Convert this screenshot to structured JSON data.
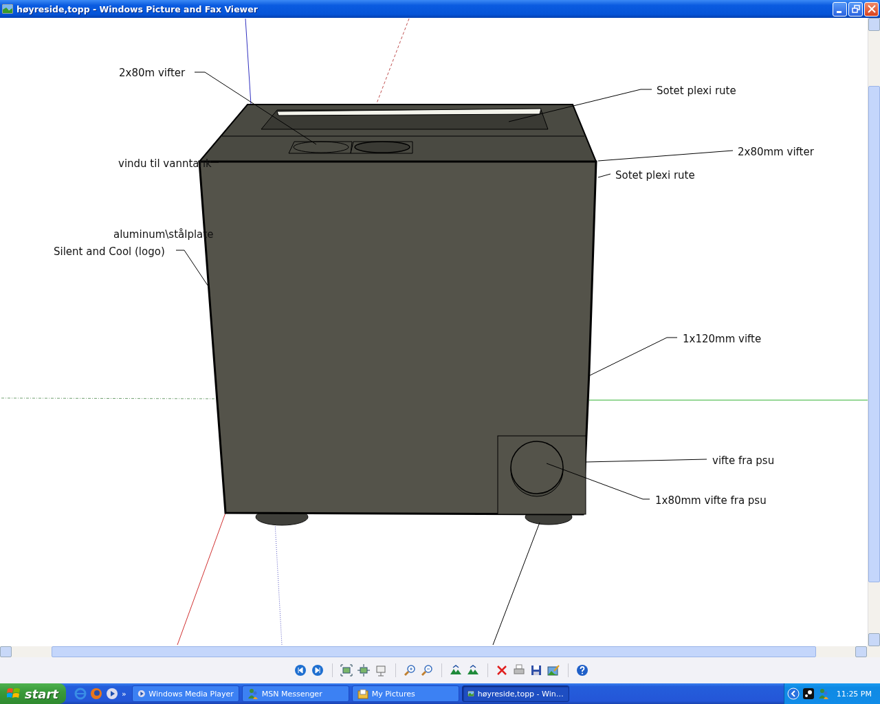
{
  "window": {
    "title": "høyreside,topp - Windows Picture and Fax Viewer"
  },
  "drawing": {
    "labels": [
      {
        "text": "2x80m vifter"
      },
      {
        "text": "Sotet plexi rute"
      },
      {
        "text": "vindu til vanntank"
      },
      {
        "text": "2x80mm vifter"
      },
      {
        "text": "Sotet plexi rute"
      },
      {
        "text": "aluminum\\stålplate"
      },
      {
        "text": "Silent and Cool (logo)"
      },
      {
        "text": "1x120mm vifte"
      },
      {
        "text": "vifte fra psu"
      },
      {
        "text": "1x80mm vifte fra psu"
      }
    ]
  },
  "taskbar": {
    "start": "start",
    "more": "»",
    "tasks": [
      {
        "label": "Windows Media Player",
        "kind": "media",
        "selected": false
      },
      {
        "label": "MSN Messenger",
        "kind": "messenger",
        "selected": false
      },
      {
        "label": "My Pictures",
        "kind": "folder",
        "selected": false
      },
      {
        "label": "høyreside,topp - Win…",
        "kind": "image",
        "selected": true
      }
    ],
    "clock": "11:25 PM"
  }
}
